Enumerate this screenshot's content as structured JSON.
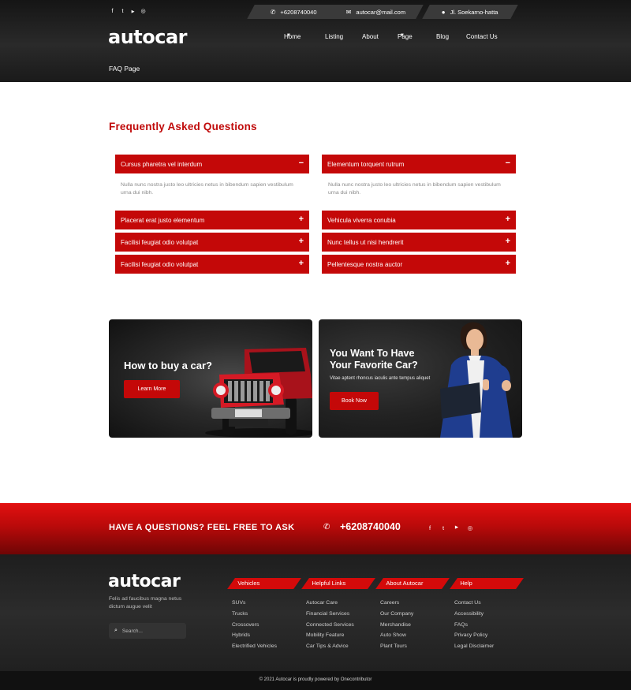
{
  "header": {
    "social_icons": [
      "facebook-icon",
      "twitter-icon",
      "youtube-icon",
      "instagram-icon"
    ],
    "social_glyphs": [
      "f",
      "t",
      "▶",
      "◎"
    ],
    "phone": "+6208740040",
    "email": "autocar@mail.com",
    "address": "Jl. Soekarno-hatta",
    "logo": "autocar",
    "nav": [
      "Home",
      "Listing",
      "About",
      "Page",
      "Blog",
      "Contact Us"
    ],
    "breadcrumb": "FAQ Page"
  },
  "faq": {
    "title": "Frequently Asked Questions",
    "left": [
      {
        "q": "Cursus pharetra vel interdum",
        "sign": "−",
        "a": "Nulla nunc nostra justo leo ultricies netus in bibendum sapien vestibulum urna dui nibh."
      },
      {
        "q": "Placerat erat justo elementum",
        "sign": "+"
      },
      {
        "q": "Facilisi feugiat odio volutpat",
        "sign": "+"
      },
      {
        "q": "Facilisi feugiat odio volutpat",
        "sign": "+"
      }
    ],
    "right": [
      {
        "q": "Elementum torquent rutrum",
        "sign": "−",
        "a": "Nulla nunc nostra justo leo ultricies netus in bibendum sapien vestibulum urna dui nibh."
      },
      {
        "q": "Vehicula viverra conubia",
        "sign": "+"
      },
      {
        "q": "Nunc tellus ut nisi hendrerit",
        "sign": "+"
      },
      {
        "q": "Pellentesque nostra auctor",
        "sign": "+"
      }
    ]
  },
  "promo": {
    "left": {
      "heading": "How to buy a car?",
      "button": "Learn More"
    },
    "right": {
      "heading_line1": "You Want To Have",
      "heading_line2": "Your Favorite Car?",
      "text": "Vitae aptent rhoncus iaculis ante tempus aliquet",
      "button": "Book Now"
    }
  },
  "cta": {
    "text": "HAVE A QUESTIONS? FEEL FREE TO ASK",
    "phone": "+6208740040",
    "social_icons": [
      "facebook-icon",
      "twitter-icon",
      "youtube-icon",
      "instagram-icon"
    ]
  },
  "footer": {
    "logo": "autocar",
    "desc": "Felis ad faucibus magna netus dictum augue velit",
    "search_placeholder": "Search...",
    "columns": [
      {
        "title": "Vehicles",
        "links": [
          "SUVs",
          "Trucks",
          "Crossovers",
          "Hybrids",
          "Electrified Vehicles"
        ]
      },
      {
        "title": "Helpful Links",
        "links": [
          "Autocar Care",
          "Financial Services",
          "Connected Services",
          "Mobility Feature",
          "Car Tips & Advice"
        ]
      },
      {
        "title": "About Autocar",
        "links": [
          "Careers",
          "Our Company",
          "Merchandise",
          "Auto Show",
          "Plant Tours"
        ]
      },
      {
        "title": "Help",
        "links": [
          "Contact Us",
          "Accessibility",
          "FAQs",
          "Privacy Policy",
          "Legal Disclaimer"
        ]
      }
    ],
    "copyright": "© 2021 Autocar is proudly powered by Onecontributor"
  },
  "colors": {
    "brand_red": "#c40808",
    "dark": "#1e1e1e"
  }
}
